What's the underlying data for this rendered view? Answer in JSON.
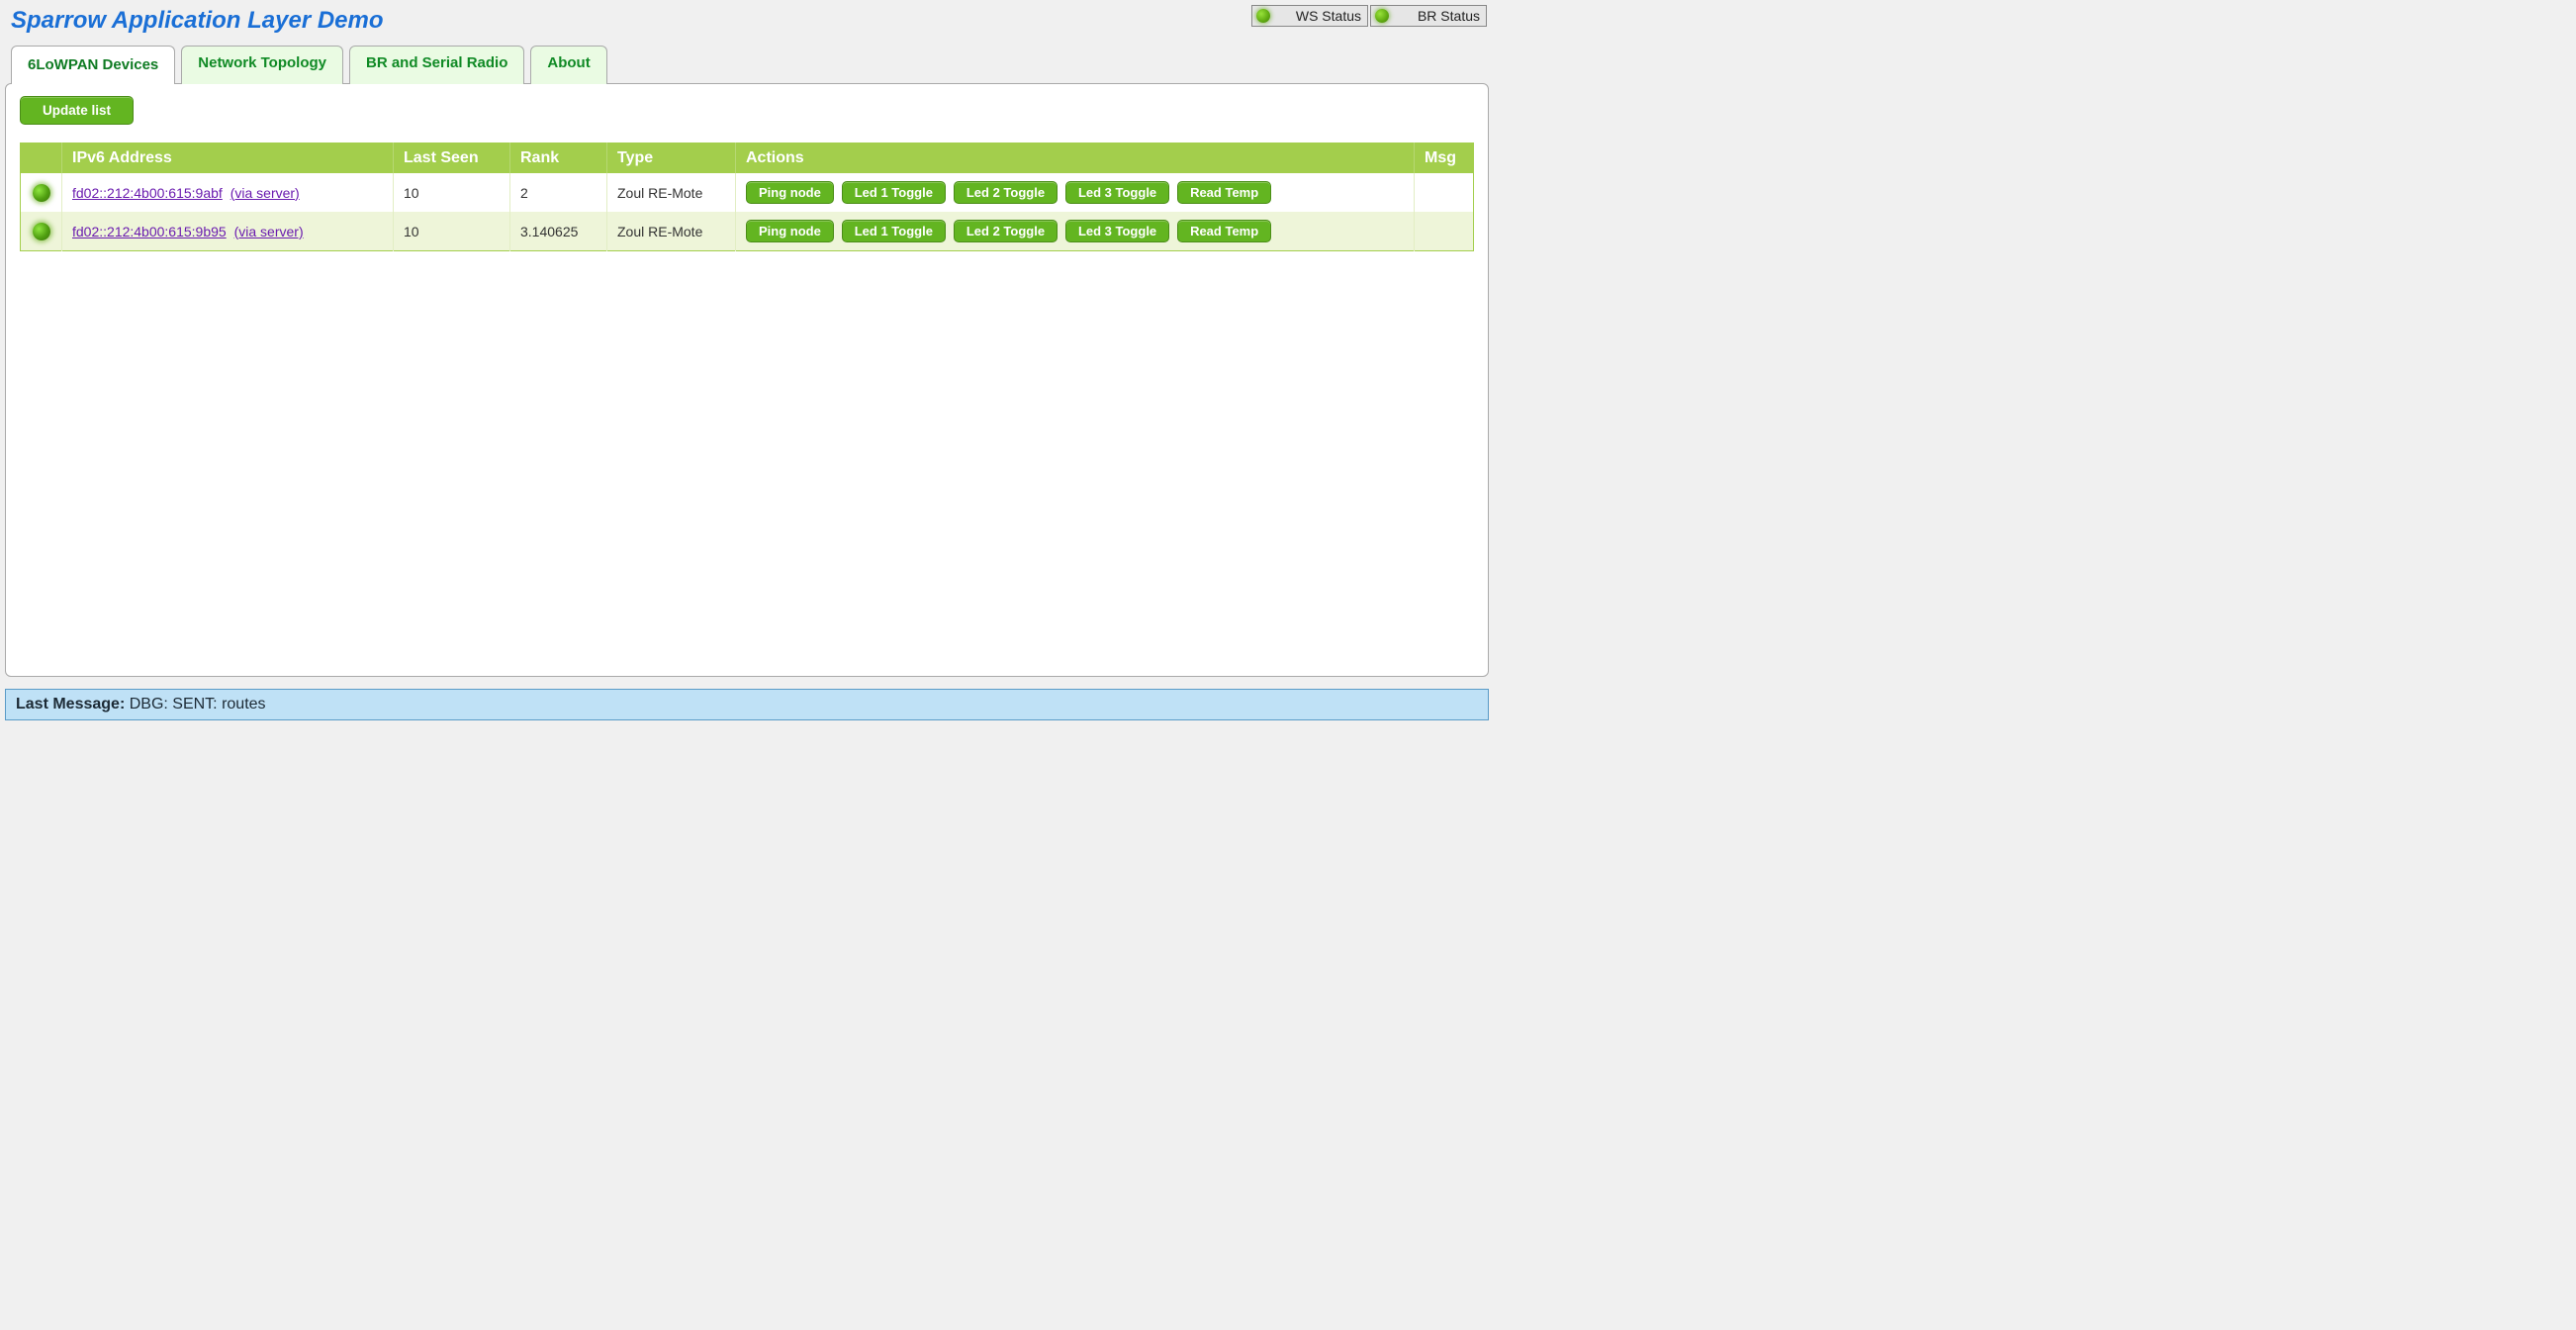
{
  "header": {
    "title": "Sparrow Application Layer Demo",
    "ws_status_label": "WS Status",
    "br_status_label": "BR Status"
  },
  "tabs": [
    {
      "label": "6LoWPAN Devices",
      "active": true
    },
    {
      "label": "Network Topology",
      "active": false
    },
    {
      "label": "BR and Serial Radio",
      "active": false
    },
    {
      "label": "About",
      "active": false
    }
  ],
  "toolbar": {
    "update_list_label": "Update list"
  },
  "table": {
    "columns": {
      "status": "",
      "address": "IPv6 Address",
      "last_seen": "Last Seen",
      "rank": "Rank",
      "type": "Type",
      "actions": "Actions",
      "msg": "Msg"
    },
    "action_labels": {
      "ping": "Ping node",
      "led1": "Led 1 Toggle",
      "led2": "Led 2 Toggle",
      "led3": "Led 3 Toggle",
      "readtemp": "Read Temp"
    },
    "via_server_label": "(via server)",
    "rows": [
      {
        "address": "fd02::212:4b00:615:9abf",
        "last_seen": "10",
        "rank": "2",
        "type": "Zoul RE-Mote",
        "msg": ""
      },
      {
        "address": "fd02::212:4b00:615:9b95",
        "last_seen": "10",
        "rank": "3.140625",
        "type": "Zoul RE-Mote",
        "msg": ""
      }
    ]
  },
  "footer": {
    "label": "Last Message:",
    "text": "DBG: SENT: routes"
  }
}
